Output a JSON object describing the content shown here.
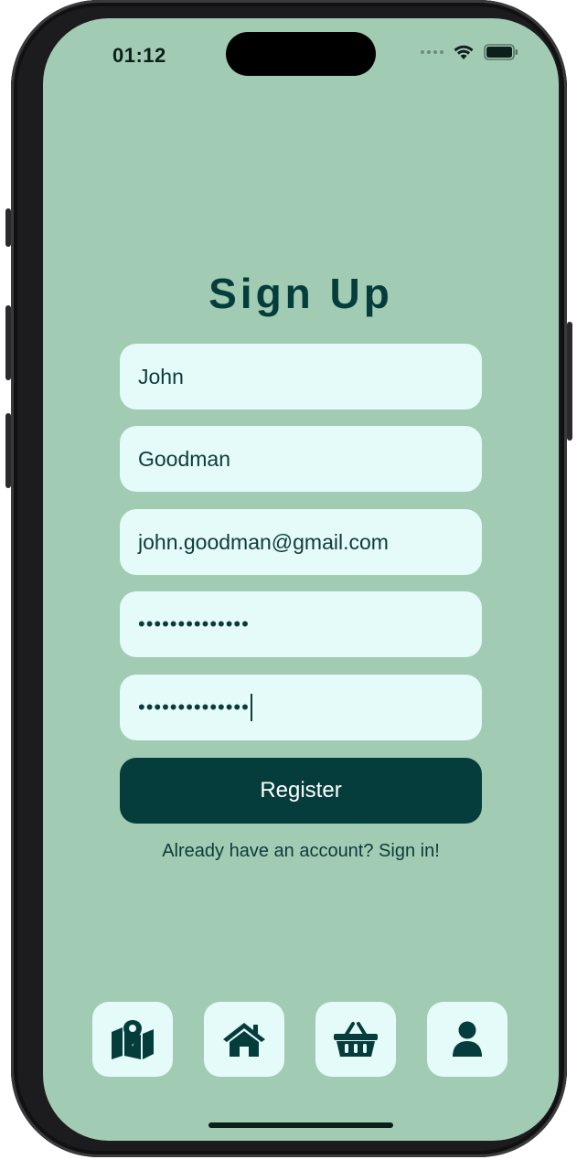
{
  "status_bar": {
    "time": "01:12",
    "icons": [
      "signal-dots-icon",
      "wifi-icon",
      "battery-icon"
    ]
  },
  "form": {
    "title": "Sign Up",
    "first_name": "John",
    "last_name": "Goodman",
    "email": "john.goodman@gmail.com",
    "password": "••••••••••••••",
    "confirm_password": "••••••••••••••",
    "register_label": "Register",
    "signin_text": "Already have an account? Sign in!"
  },
  "tab_bar": {
    "items": [
      {
        "icon": "map-icon"
      },
      {
        "icon": "home-icon"
      },
      {
        "icon": "basket-icon"
      },
      {
        "icon": "user-icon"
      }
    ]
  },
  "colors": {
    "background": "#a2cbb4",
    "field_background": "#e4fbf9",
    "primary": "#053d3c",
    "text": "#0d3b3a"
  }
}
